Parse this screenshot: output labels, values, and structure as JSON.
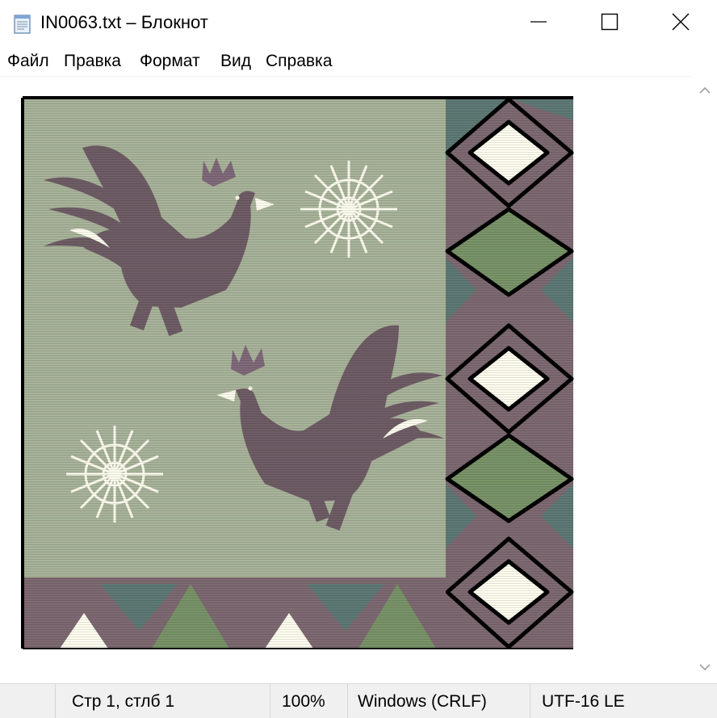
{
  "window": {
    "title": "IN0063.txt – Блокнот",
    "icon": "notepad-icon"
  },
  "controls": {
    "minimize": "minimize-icon",
    "maximize": "maximize-icon",
    "close": "close-icon"
  },
  "menu": {
    "items": [
      "Файл",
      "Правка",
      "Формат",
      "Вид",
      "Справка"
    ]
  },
  "content": {
    "description_icon": "ascii-art",
    "colors": {
      "background": "#a9b49b",
      "bird": "#6f5d66",
      "green": "#7a9469",
      "teal": "#5f7a76",
      "cream": "#fffef0",
      "mauve": "#7e6a72",
      "outline": "#000000"
    }
  },
  "scrollbar": {
    "up": "chevron-up-icon",
    "down": "chevron-down-icon"
  },
  "status": {
    "position": "Стр 1, стлб 1",
    "zoom": "100%",
    "line_endings": "Windows (CRLF)",
    "encoding": "UTF-16 LE"
  }
}
